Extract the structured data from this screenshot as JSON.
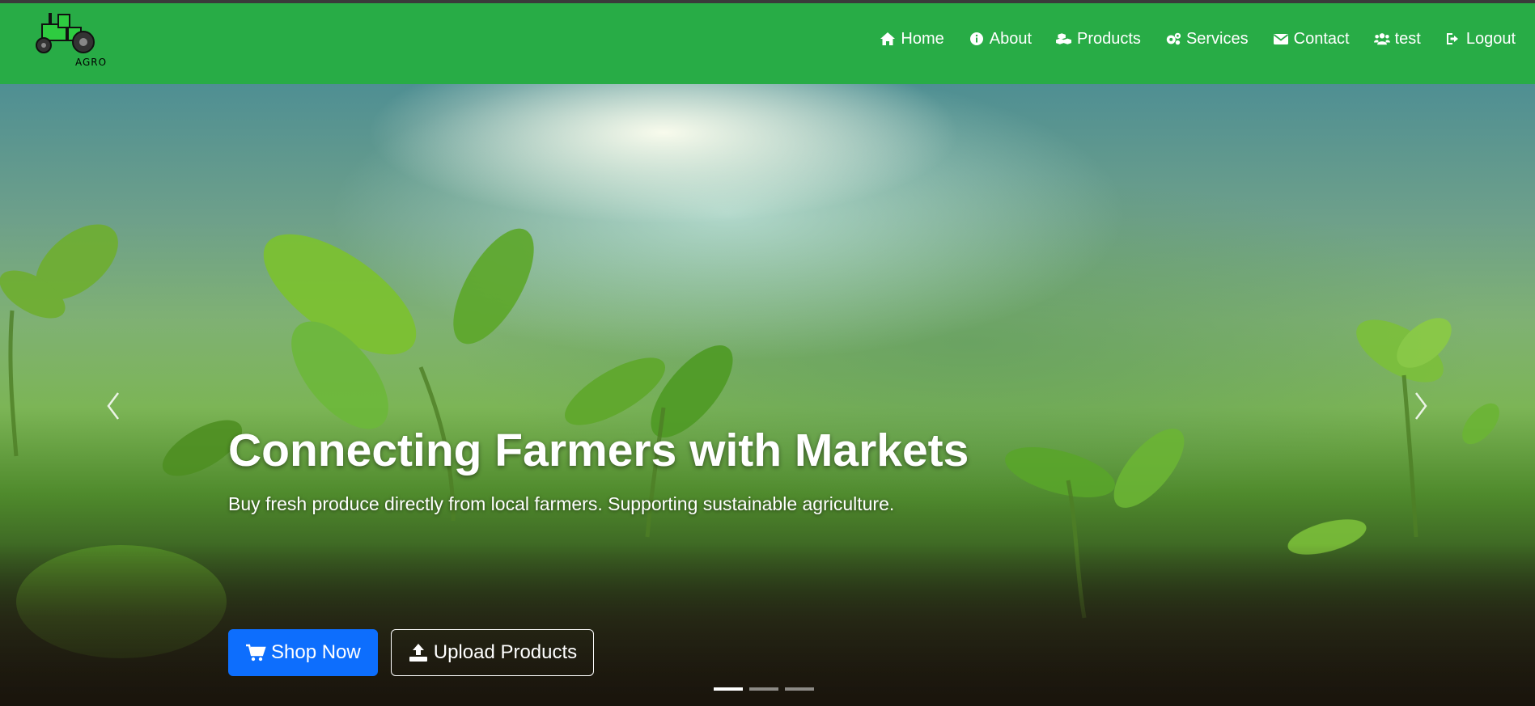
{
  "brand": {
    "logo_text": "AGRO",
    "colors": {
      "navbar": "#28ac46",
      "primary_button": "#0d6efd"
    }
  },
  "nav": {
    "items": [
      {
        "label": "Home",
        "icon": "home-icon"
      },
      {
        "label": "About",
        "icon": "info-circle-icon"
      },
      {
        "label": "Products",
        "icon": "cubes-icon"
      },
      {
        "label": "Services",
        "icon": "cogs-icon"
      },
      {
        "label": "Contact",
        "icon": "envelope-icon"
      },
      {
        "label": "test",
        "icon": "users-icon"
      },
      {
        "label": "Logout",
        "icon": "sign-out-icon"
      }
    ]
  },
  "hero": {
    "title": "Connecting Farmers with Markets",
    "subtitle": "Buy fresh produce directly from local farmers. Supporting sustainable agriculture.",
    "shop_button": {
      "label": "Shop Now",
      "icon": "cart-icon"
    },
    "upload_button": {
      "label": "Upload Products",
      "icon": "upload-icon"
    },
    "carousel": {
      "slide_count": 3,
      "active_slide": 1
    }
  }
}
